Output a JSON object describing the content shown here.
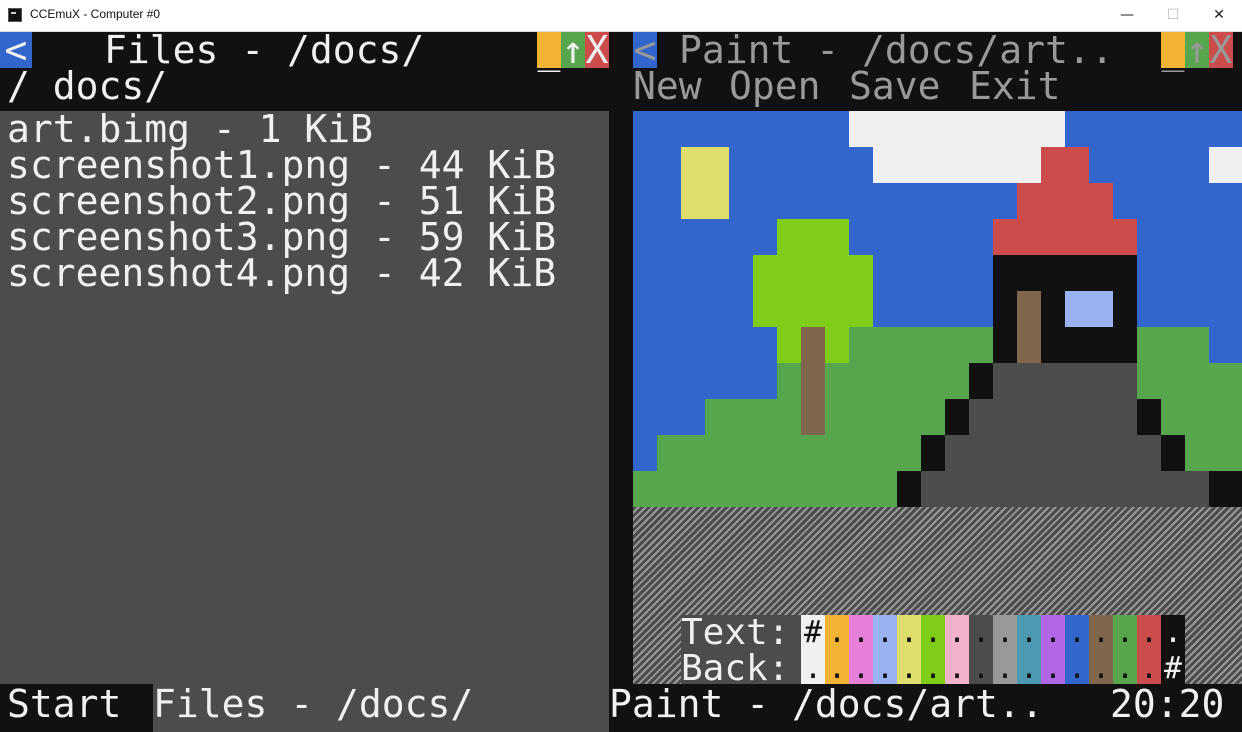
{
  "window": {
    "title": "CCEmuX - Computer #0",
    "minimize": "—",
    "maximize": "☐",
    "close": "✕"
  },
  "files_window": {
    "back": "<",
    "title": "Files - /docs/",
    "min": "_",
    "max": "↑",
    "close": "X",
    "path": "/ docs/",
    "files": [
      {
        "name": "art.bimg - 1 KiB"
      },
      {
        "name": "screenshot1.png - 44 KiB"
      },
      {
        "name": "screenshot2.png - 51 KiB"
      },
      {
        "name": "screenshot3.png - 59 KiB"
      },
      {
        "name": "screenshot4.png - 42 KiB"
      }
    ]
  },
  "paint_window": {
    "back": "<",
    "title": "Paint - /docs/art..",
    "min": "_",
    "max": "↑",
    "close": "X",
    "menu": [
      "New",
      "Open",
      "Save",
      "Exit"
    ],
    "palette": {
      "text_label": "Text:",
      "back_label": "Back:",
      "selected_text_marker": "#",
      "selected_back_marker": "#",
      "colors": [
        "#f0f0f0",
        "#f2b233",
        "#e57fd8",
        "#99b2f2",
        "#dede6c",
        "#7fcc19",
        "#f2b2cc",
        "#4c4c4c",
        "#999999",
        "#4c99b2",
        "#b266e5",
        "#3366cc",
        "#7f664c",
        "#57a64e",
        "#cc4c4c",
        "#111111"
      ]
    }
  },
  "taskbar": {
    "start": "Start",
    "task_files": "Files - /docs/",
    "task_paint": "Paint - /docs/art..",
    "clock": "20:20"
  },
  "colors": {
    "blue": "#3366cc",
    "orange": "#f2b233",
    "green": "#57a64e",
    "red": "#cc4c4c",
    "gray": "#4c4c4c",
    "black": "#111111",
    "white": "#f0f0f0"
  }
}
